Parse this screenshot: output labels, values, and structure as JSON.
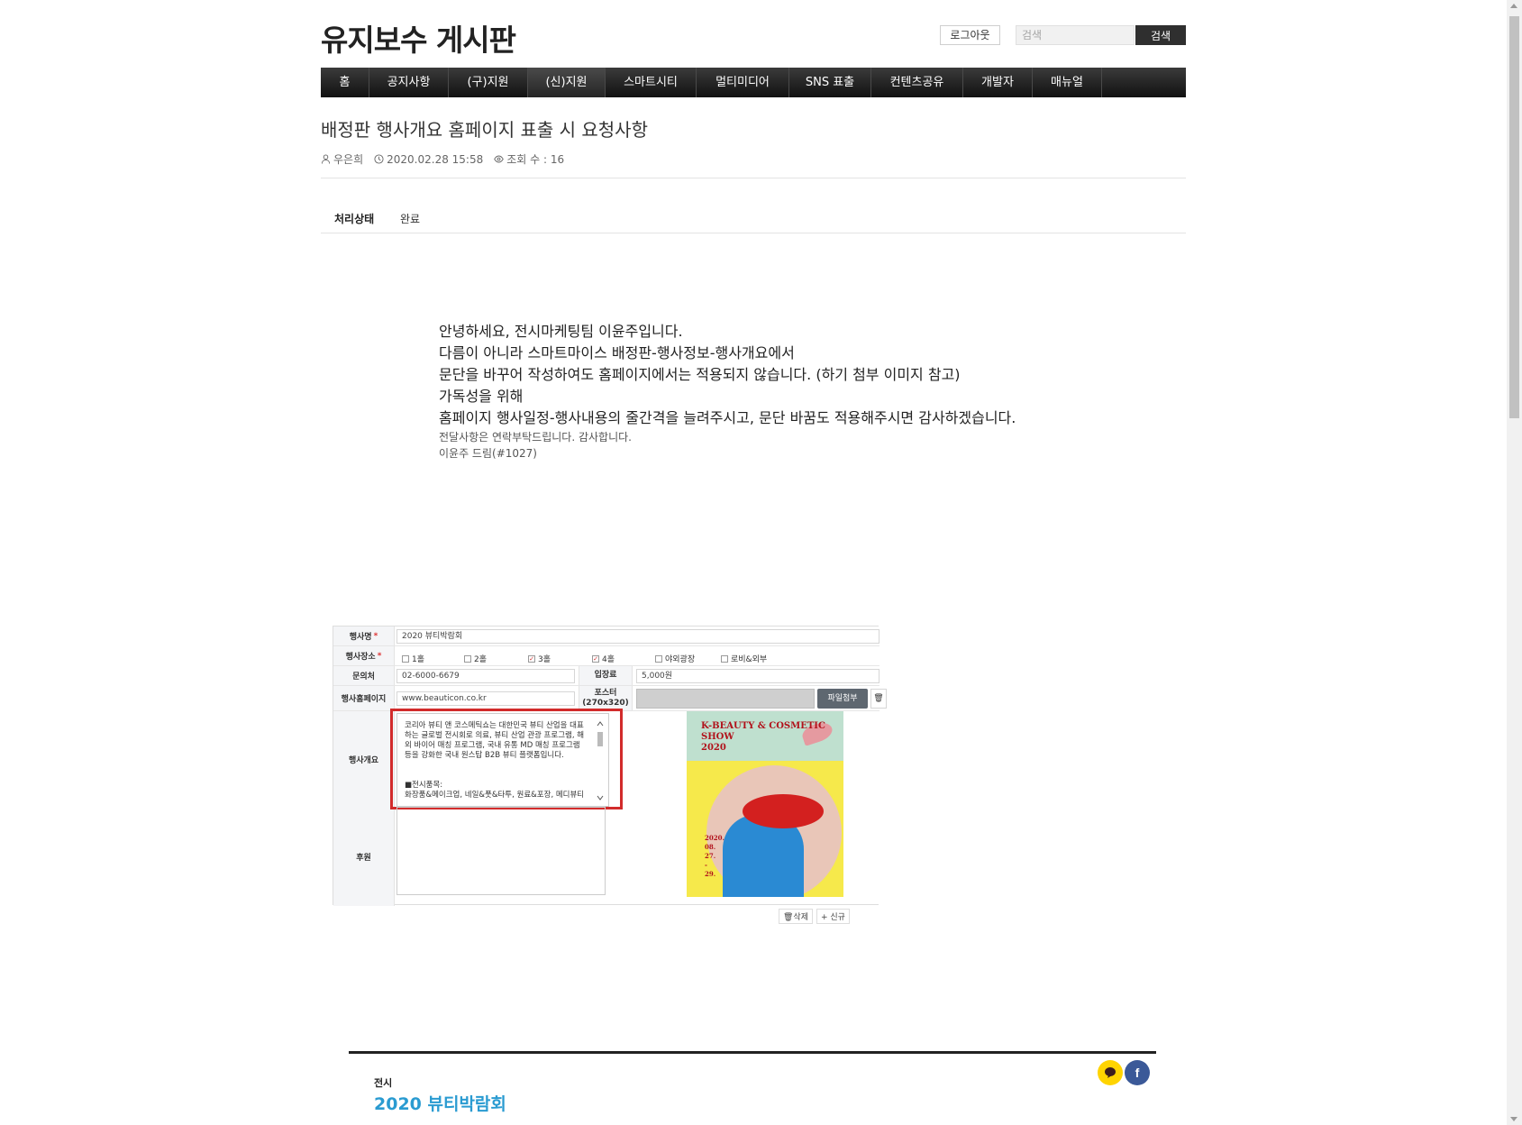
{
  "header": {
    "site_title": "유지보수 게시판",
    "logout_label": "로그아웃",
    "search_placeholder": "검색",
    "search_label": "검색"
  },
  "nav": {
    "items": [
      {
        "label": "홈"
      },
      {
        "label": "공지사항"
      },
      {
        "label": "(구)지원"
      },
      {
        "label": "(신)지원"
      },
      {
        "label": "스마트시티"
      },
      {
        "label": "멀티미디어"
      },
      {
        "label": "SNS 표출"
      },
      {
        "label": "컨텐츠공유"
      },
      {
        "label": "개발자"
      },
      {
        "label": "매뉴얼"
      }
    ]
  },
  "post": {
    "title": "배정판 행사개요 홈페이지 표출 시 요청사항",
    "author": "우은희",
    "datetime": "2020.02.28 15:58",
    "views": "조회 수 : 16",
    "status_label": "처리상태",
    "status_value": "완료",
    "lines": [
      "안녕하세요, 전시마케팅팀 이윤주입니다.",
      "다름이 아니라 스마트마이스 배정판-행사정보-행사개요에서",
      "문단을 바꾸어 작성하여도 홈페이지에서는 적용되지 않습니다. (하기 첨부 이미지 참고)",
      "가독성을 위해",
      "홈페이지 행사일정-행사내용의 줄간격을 늘려주시고, 문단 바꿈도 적용해주시면 감사하겠습니다."
    ],
    "small_lines": [
      "전달사항은 연락부탁드립니다. 감사합니다.",
      "이윤주 드림(#1027)"
    ]
  },
  "attachment": {
    "event_name_label": "행사명",
    "event_name": "2020 뷰티박람회",
    "venue_label": "행사장소",
    "venues": [
      {
        "label": "1홀",
        "checked": false
      },
      {
        "label": "2홀",
        "checked": false
      },
      {
        "label": "3홀",
        "checked": true
      },
      {
        "label": "4홀",
        "checked": true
      },
      {
        "label": "야외광장",
        "checked": false
      },
      {
        "label": "로비&외부",
        "checked": false
      }
    ],
    "contact_label": "문의처",
    "contact": "02-6000-6679",
    "fee_label": "입장료",
    "fee": "5,000원",
    "homepage_label": "행사홈페이지",
    "homepage": "www.beauticon.co.kr",
    "poster_label": "포스터",
    "poster_size": "(270x320)",
    "file_button": "파일첨부",
    "trash_icon_text": "🗑",
    "overview_label": "행사개요",
    "overview_text": "코리아 뷰티 앤 코스메틱쇼는 대한민국 뷰티 산업을 대표하는 글로벌 전시회로 의료, 뷰티 산업 관광 프로그램, 해외 바이어 매칭 프로그램, 국내 유통 MD 매칭 프로그램 등을 강화한 국내 원스탑 B2B 뷰티 플랫폼입니다.",
    "overview_text2": "■전시품목:",
    "overview_text3": "화장품&메이크업, 네일&풋&타투, 원료&포장, 메디뷰티",
    "sponsor_label": "후원",
    "poster_title": "K-BEAUTY & COSMETIC SHOW",
    "poster_year": "2020",
    "poster_dates": [
      "2020.",
      "08.",
      "27.",
      "-",
      "29."
    ],
    "delete_label": "🗑삭제",
    "new_label": "+ 신규"
  },
  "footer": {
    "category": "전시",
    "event": "2020 뷰티박람회",
    "fb_glyph": "f"
  }
}
